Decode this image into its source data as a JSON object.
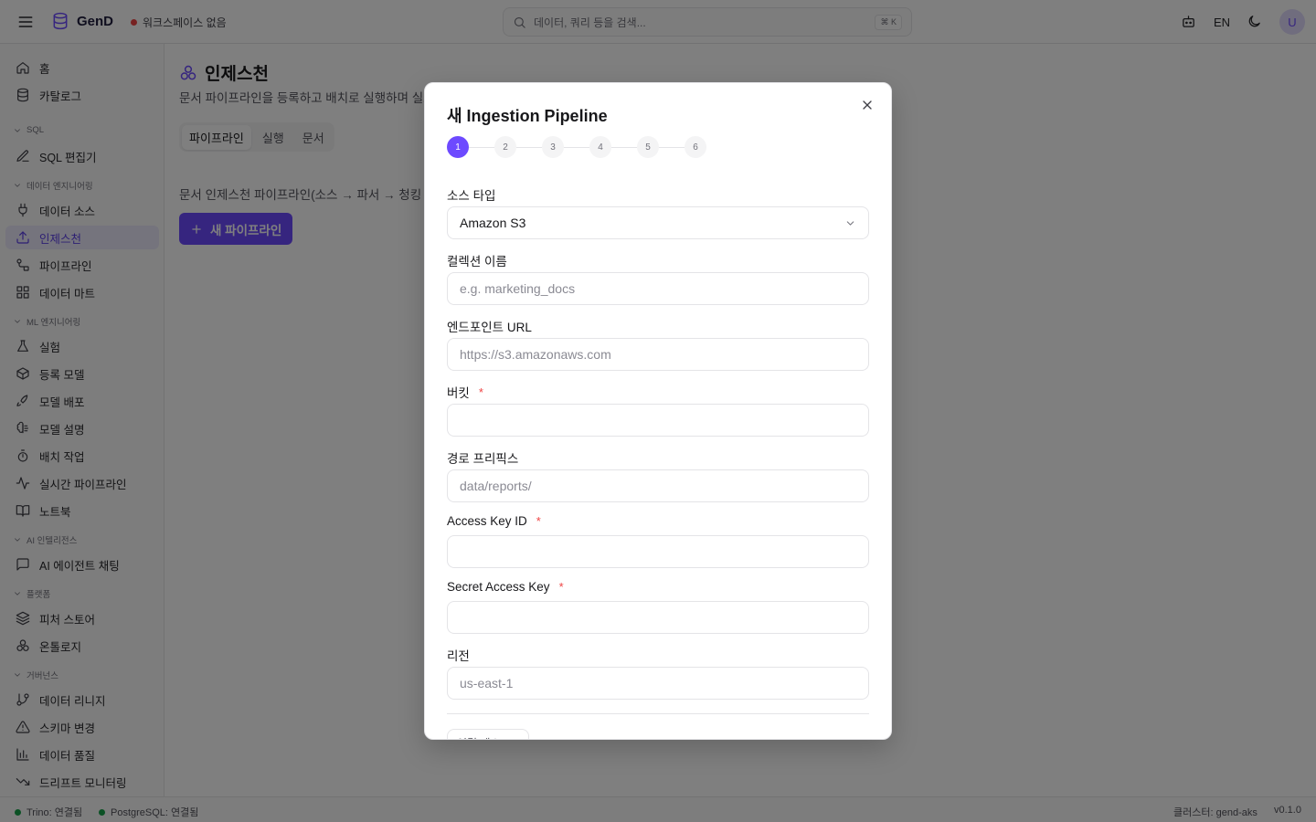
{
  "app": {
    "name": "GenD",
    "workspace_status": "워크스페이스 없음",
    "search_placeholder": "데이터, 쿼리 등을 검색...",
    "search_shortcut": "⌘ K",
    "language": "EN",
    "avatar_initial": "U",
    "brand_color": "#6d4aff"
  },
  "sidebar": {
    "items_top": [
      {
        "label": "홈",
        "icon": "home-icon"
      },
      {
        "label": "카탈로그",
        "icon": "database-icon"
      }
    ],
    "sections": [
      {
        "title": "SQL",
        "items": [
          {
            "label": "SQL 편집기",
            "icon": "edit-icon"
          }
        ]
      },
      {
        "title": "데이터 엔지니어링",
        "items": [
          {
            "label": "데이터 소스",
            "icon": "plug-icon"
          },
          {
            "label": "인제스천",
            "icon": "upload-icon",
            "active": true
          },
          {
            "label": "파이프라인",
            "icon": "workflow-icon"
          },
          {
            "label": "데이터 마트",
            "icon": "grid-icon"
          }
        ]
      },
      {
        "title": "ML 엔지니어링",
        "items": [
          {
            "label": "실험",
            "icon": "flask-icon"
          },
          {
            "label": "등록 모델",
            "icon": "package-icon"
          },
          {
            "label": "모델 배포",
            "icon": "rocket-icon"
          },
          {
            "label": "모델 설명",
            "icon": "brain-icon"
          },
          {
            "label": "배치 작업",
            "icon": "timer-icon"
          },
          {
            "label": "실시간 파이프라인",
            "icon": "activity-icon"
          },
          {
            "label": "노트북",
            "icon": "book-icon"
          }
        ]
      },
      {
        "title": "AI 인텔리전스",
        "items": [
          {
            "label": "AI 에이전트 채팅",
            "icon": "chat-icon"
          }
        ]
      },
      {
        "title": "플랫폼",
        "items": [
          {
            "label": "피처 스토어",
            "icon": "layers-icon"
          },
          {
            "label": "온톨로지",
            "icon": "ontology-icon"
          }
        ]
      },
      {
        "title": "거버넌스",
        "items": [
          {
            "label": "데이터 리니지",
            "icon": "git-branch-icon"
          },
          {
            "label": "스키마 변경",
            "icon": "warning-icon"
          },
          {
            "label": "데이터 품질",
            "icon": "bar-chart-icon"
          },
          {
            "label": "드리프트 모니터링",
            "icon": "trending-down-icon"
          }
        ]
      }
    ]
  },
  "page": {
    "title": "인제스천",
    "subtitle": "문서 파이프라인을 등록하고 배치로 실행하며 실프",
    "tabs": [
      "파이프라인",
      "실행",
      "문서"
    ],
    "description": "문서 인제스천 파이프라인(소스 → 파서 → 청킹 -",
    "new_button": "새 파이프라인"
  },
  "modal": {
    "title": "새 Ingestion Pipeline",
    "steps": [
      "1",
      "2",
      "3",
      "4",
      "5",
      "6"
    ],
    "active_step": 1,
    "fields": {
      "source_type": {
        "label": "소스 타입",
        "value": "Amazon S3"
      },
      "collection_name": {
        "label": "컬렉션 이름",
        "placeholder": "e.g. marketing_docs",
        "value": ""
      },
      "endpoint_url": {
        "label": "엔드포인트 URL",
        "placeholder": "https://s3.amazonaws.com",
        "value": ""
      },
      "bucket": {
        "label": "버킷",
        "required_mark": "*",
        "value": ""
      },
      "path_prefix": {
        "label": "경로 프리픽스",
        "placeholder": "data/reports/",
        "value": ""
      },
      "access_key_id": {
        "label": "Access Key ID",
        "required_mark": "*",
        "value": ""
      },
      "secret_access_key": {
        "label": "Secret Access Key",
        "required_mark": "*",
        "value": ""
      },
      "region": {
        "label": "리전",
        "placeholder": "us-east-1",
        "value": ""
      }
    },
    "connection_test_label": "연결 테스트"
  },
  "statusbar": {
    "trino": "Trino: 연결됨",
    "postgres": "PostgreSQL: 연결됨",
    "cluster": "클러스터: gend-aks",
    "version": "v0.1.0"
  }
}
